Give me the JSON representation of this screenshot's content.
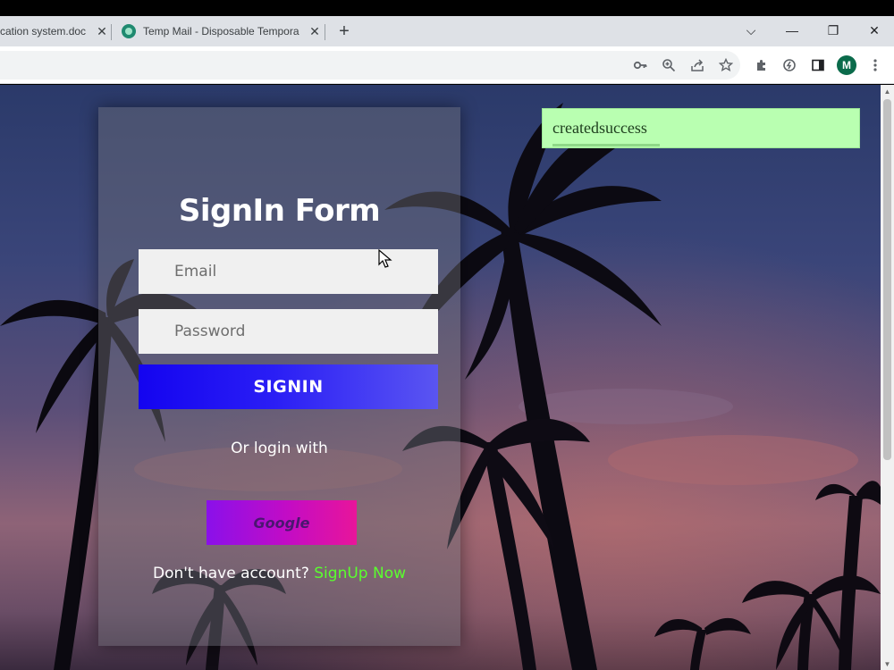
{
  "browser": {
    "tabs": [
      {
        "label": "cation system.doc",
        "close": "✕"
      },
      {
        "label": "Temp Mail - Disposable Tempora",
        "close": "✕"
      }
    ],
    "new_tab": "+",
    "window_controls": {
      "dropdown": "⌵",
      "minimize": "—",
      "restore": "❐",
      "close": "✕"
    },
    "profile_initial": "M",
    "toolbar_icons": [
      "key-icon",
      "zoom-icon",
      "share-icon",
      "star-icon",
      "extensions-icon",
      "extension-icon",
      "side-panel-icon",
      "menu-icon"
    ]
  },
  "page": {
    "form": {
      "title": "SignIn Form",
      "email_placeholder": "Email",
      "password_placeholder": "Password",
      "signin_label": "SIGNIN",
      "or_text": "Or login with",
      "google_label": "Google",
      "signup_prompt": "Don't have account?",
      "signup_link": "SignUp Now"
    },
    "toast": {
      "message": "createdsuccess"
    }
  },
  "colors": {
    "signin_button": "#1404f0",
    "google_gradient_start": "#8a10ea",
    "google_gradient_end": "#e8159a",
    "signup_link": "#5aff2e",
    "toast_bg": "#b9ffb1"
  }
}
